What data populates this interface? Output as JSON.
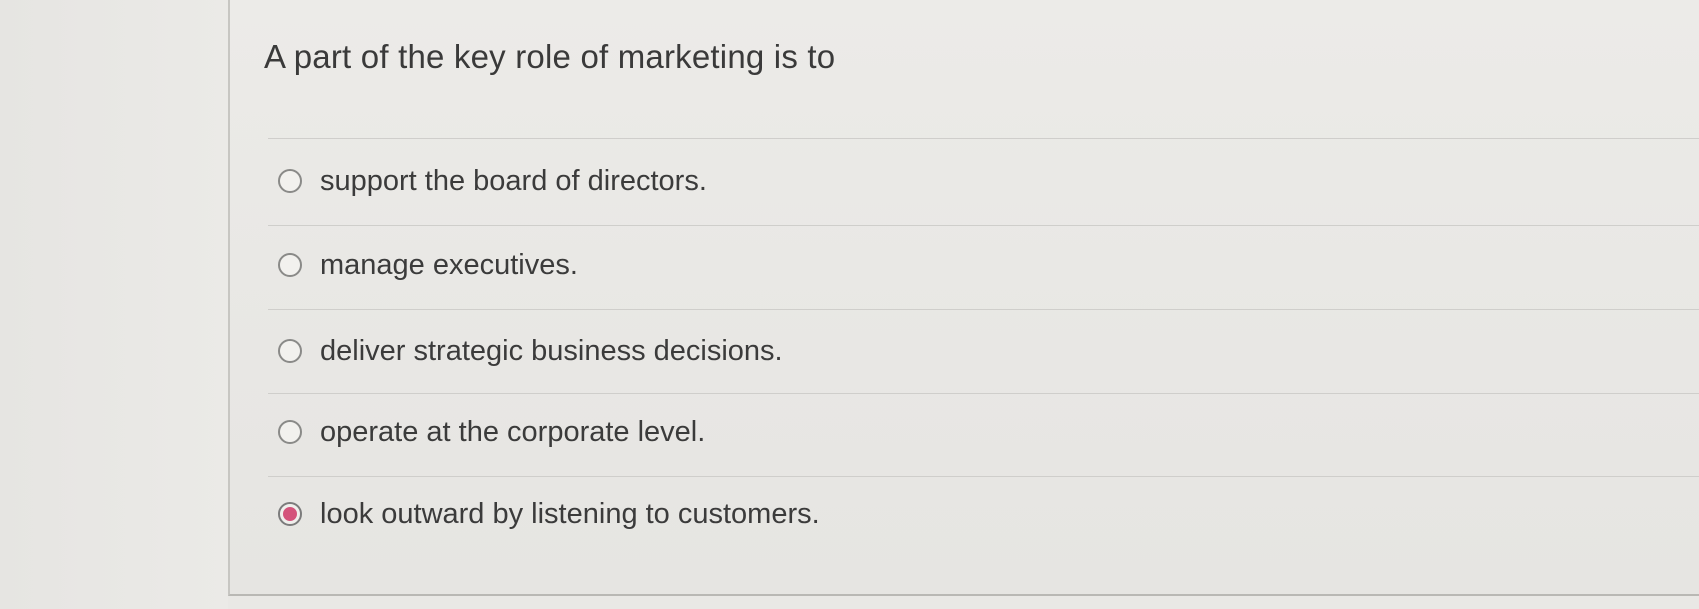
{
  "question": {
    "text": "A part of the key role of marketing is to"
  },
  "options": [
    {
      "label": "support the board of directors.",
      "selected": false
    },
    {
      "label": "manage executives.",
      "selected": false
    },
    {
      "label": "deliver strategic business decisions.",
      "selected": false
    },
    {
      "label": "operate at the corporate level.",
      "selected": false
    },
    {
      "label": "look outward by listening to customers.",
      "selected": true
    }
  ],
  "colors": {
    "selected_radio": "#d4537b",
    "background": "#e9e8e5",
    "text": "#3a3a3a"
  }
}
